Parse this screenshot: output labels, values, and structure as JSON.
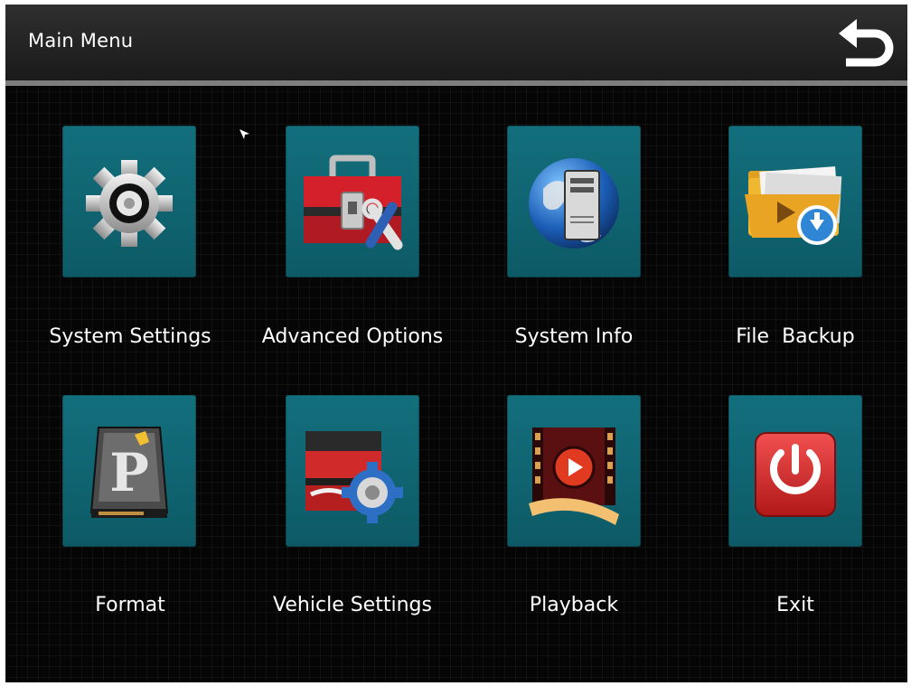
{
  "header": {
    "title": "Main Menu",
    "back_icon": "return-arrow-icon"
  },
  "menu": {
    "items": [
      {
        "label": "System Settings",
        "icon": "gear-icon"
      },
      {
        "label": "Advanced Options",
        "icon": "toolbox-icon"
      },
      {
        "label": "System Info",
        "icon": "globe-computer-icon"
      },
      {
        "label": "File  Backup",
        "icon": "folder-backup-icon"
      },
      {
        "label": "Format",
        "icon": "hard-drive-icon"
      },
      {
        "label": "Vehicle Settings",
        "icon": "vehicle-gear-icon"
      },
      {
        "label": "Playback",
        "icon": "film-play-icon"
      },
      {
        "label": "Exit",
        "icon": "power-icon"
      }
    ]
  },
  "colors": {
    "tile": "#136f7d",
    "background": "#050505",
    "header": "#262626",
    "text": "#ffffff"
  }
}
